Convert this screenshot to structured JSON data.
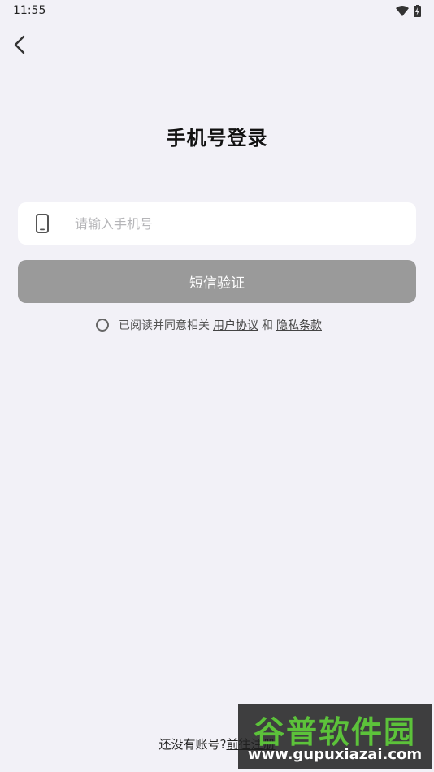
{
  "status_bar": {
    "time": "11:55"
  },
  "title": "手机号登录",
  "phone": {
    "placeholder": "请输入手机号",
    "value": ""
  },
  "sms_button": "短信验证",
  "agreement": {
    "prefix": "已阅读并同意相关",
    "user_agreement": "用户协议",
    "and": "和",
    "privacy_terms": "隐私条款"
  },
  "footer": {
    "prompt": "还没有账号?",
    "register": "前往注册"
  },
  "watermark": {
    "title": "谷普软件园",
    "url": "www.gupuxiazai.com"
  },
  "colors": {
    "background": "#f2f1f7",
    "button_disabled": "#9a9a9a",
    "field_bg": "#ffffff"
  }
}
